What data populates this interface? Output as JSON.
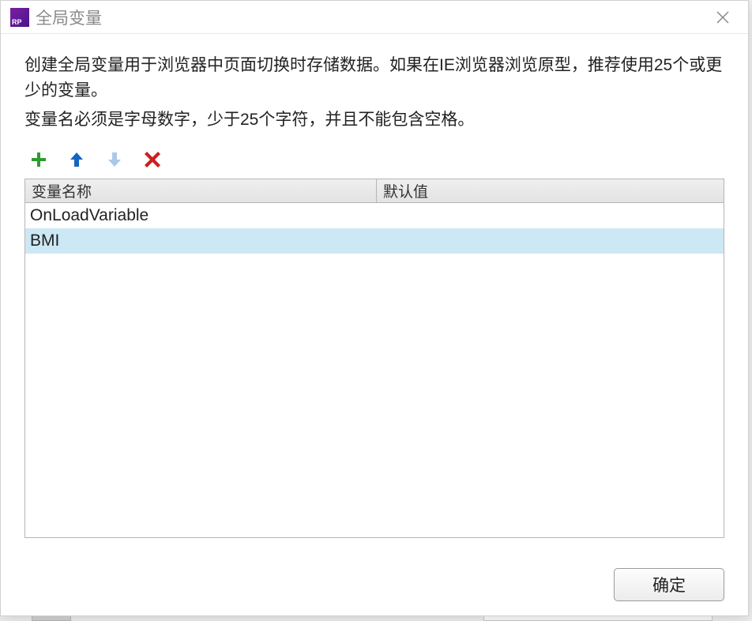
{
  "titlebar": {
    "app_icon_text": "RP",
    "title": "全局变量"
  },
  "description": {
    "line1": "创建全局变量用于浏览器中页面切换时存储数据。如果在IE浏览器浏览原型，推荐使用25个或更少的变量。",
    "line2": "变量名必须是字母数字，少于25个字符，并且不能包含空格。"
  },
  "toolbar": {
    "add_name": "add-icon",
    "up_name": "move-up-icon",
    "down_name": "move-down-icon",
    "delete_name": "delete-icon"
  },
  "table": {
    "header_name": "变量名称",
    "header_default": "默认值",
    "rows": [
      {
        "name": "OnLoadVariable",
        "default": "",
        "selected": false
      },
      {
        "name": "BMI",
        "default": "",
        "selected": true
      }
    ]
  },
  "footer": {
    "ok_label": "确定"
  },
  "colors": {
    "accent_green": "#2e9b2e",
    "accent_blue": "#1565c0",
    "accent_red": "#cc1f1f",
    "selected_row": "#cce8f4"
  }
}
